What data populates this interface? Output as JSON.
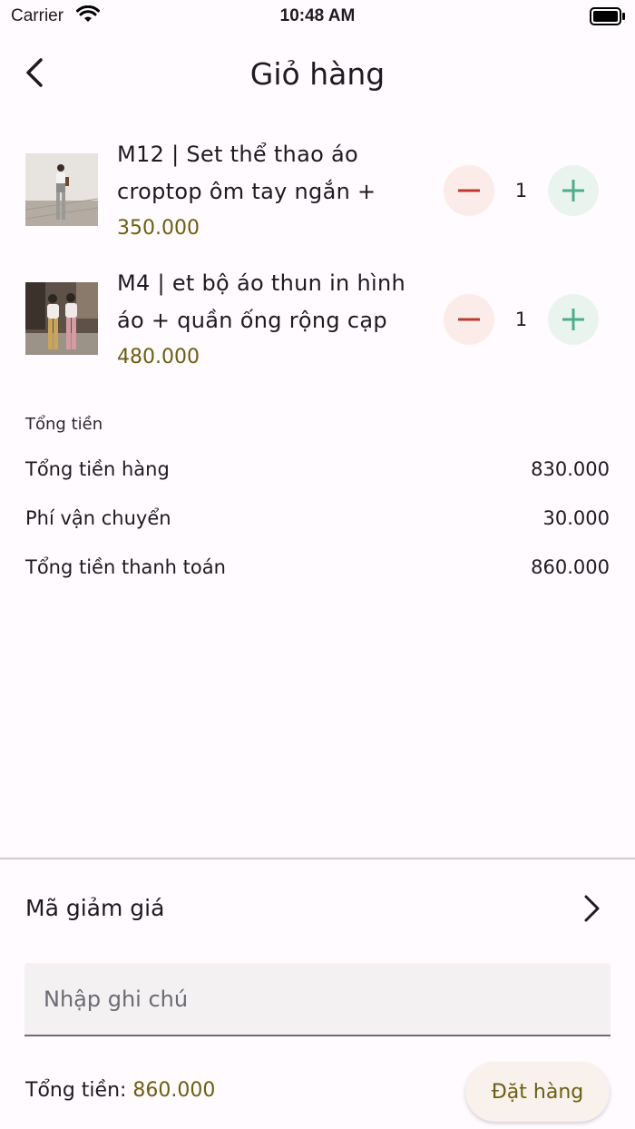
{
  "status_bar": {
    "carrier": "Carrier",
    "time": "10:48 AM"
  },
  "header": {
    "title": "Giỏ hàng"
  },
  "cart": {
    "items": [
      {
        "name": "M12 | Set thể thao áo croptop ôm tay ngắn +",
        "price": "350.000",
        "quantity": "1"
      },
      {
        "name": "M4 | et bộ áo thun in hình áo + quần ống rộng cạp",
        "price": "480.000",
        "quantity": "1"
      }
    ]
  },
  "summary": {
    "heading": "Tổng tiền",
    "rows": [
      {
        "label": "Tổng tiền hàng",
        "value": "830.000"
      },
      {
        "label": "Phí vận chuyển",
        "value": "30.000"
      },
      {
        "label": "Tổng tiền thanh toán",
        "value": "860.000"
      }
    ]
  },
  "coupon": {
    "label": "Mã giảm giá"
  },
  "note": {
    "placeholder": "Nhập ghi chú",
    "value": ""
  },
  "footer": {
    "total_label": "Tổng tiền: ",
    "total_value": "860.000",
    "order_button": "Đặt hàng"
  },
  "colors": {
    "accent": "#6b5f14",
    "minus": "#c0392b",
    "plus": "#4caf8a",
    "background": "#fffbfe"
  },
  "icons": {
    "back": "chevron-left-icon",
    "minus": "minus-icon",
    "plus": "plus-icon",
    "coupon": "chevron-right-icon"
  }
}
